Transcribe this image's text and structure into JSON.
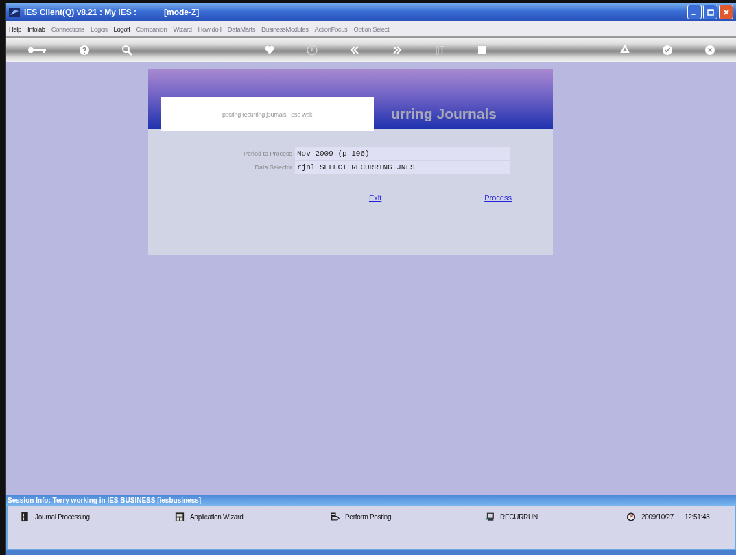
{
  "window": {
    "title": "IES Client(Q) v8.21 : My IES :",
    "mode": "[mode-Z]"
  },
  "menu": [
    {
      "label": "Help",
      "disabled": false
    },
    {
      "label": "Infolab",
      "disabled": false
    },
    {
      "label": "Connections",
      "disabled": true
    },
    {
      "label": "Logon",
      "disabled": true
    },
    {
      "label": "Logoff",
      "disabled": false
    },
    {
      "label": "Companion",
      "disabled": true
    },
    {
      "label": "Wizard",
      "disabled": true
    },
    {
      "label": "How do I",
      "disabled": true
    },
    {
      "label": "DataMarts",
      "disabled": true
    },
    {
      "label": "BusinessModules",
      "disabled": true
    },
    {
      "label": "ActionFocus",
      "disabled": true
    },
    {
      "label": "Option Select",
      "disabled": true
    }
  ],
  "dialog": {
    "title": "urring Journals",
    "popup": "posting recurring journals - pse wait",
    "fields": [
      {
        "label": "Period to Process",
        "value": "Nov 2009 (p 106)"
      },
      {
        "label": "Data Selector",
        "value": "rjnl SELECT RECURRING JNLS"
      }
    ],
    "links": [
      "Exit",
      "Process"
    ]
  },
  "status_bar": {
    "session": "Session Info: Terry working in IES BUSINESS  [iesbusiness]",
    "items": [
      {
        "kind": "journal",
        "label": "Journal Processing"
      },
      {
        "kind": "wizard",
        "label": "Application Wizard"
      },
      {
        "kind": "posting",
        "label": "Perform Posting"
      },
      {
        "kind": "recur",
        "label": "RECURRUN"
      }
    ],
    "date": "2009/10/27",
    "time": "12:51:43"
  }
}
